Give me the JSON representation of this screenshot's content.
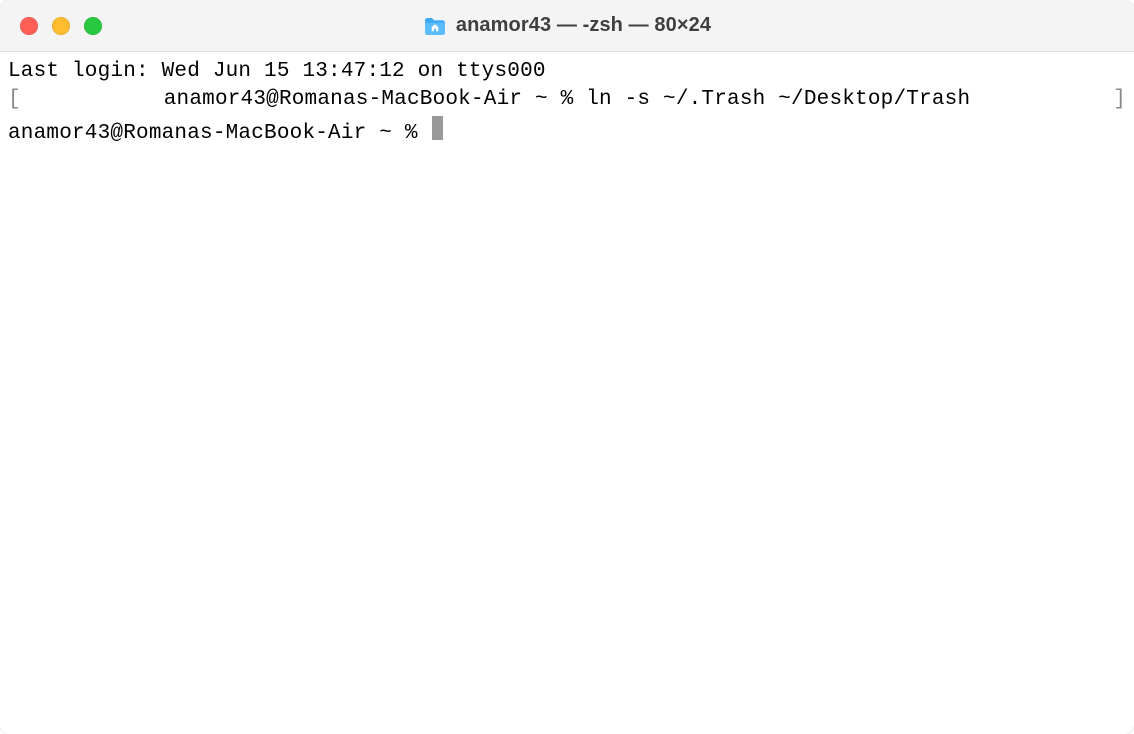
{
  "window": {
    "title": "anamor43 — -zsh — 80×24"
  },
  "terminal": {
    "lines": [
      {
        "bracketed": false,
        "text": "Last login: Wed Jun 15 13:47:12 on ttys000"
      },
      {
        "bracketed": true,
        "text": "anamor43@Romanas-MacBook-Air ~ % ln -s ~/.Trash ~/Desktop/Trash"
      },
      {
        "bracketed": false,
        "prompt": "anamor43@Romanas-MacBook-Air ~ % ",
        "cursor": true
      }
    ],
    "brackets": {
      "left": "[",
      "right": "]"
    }
  }
}
